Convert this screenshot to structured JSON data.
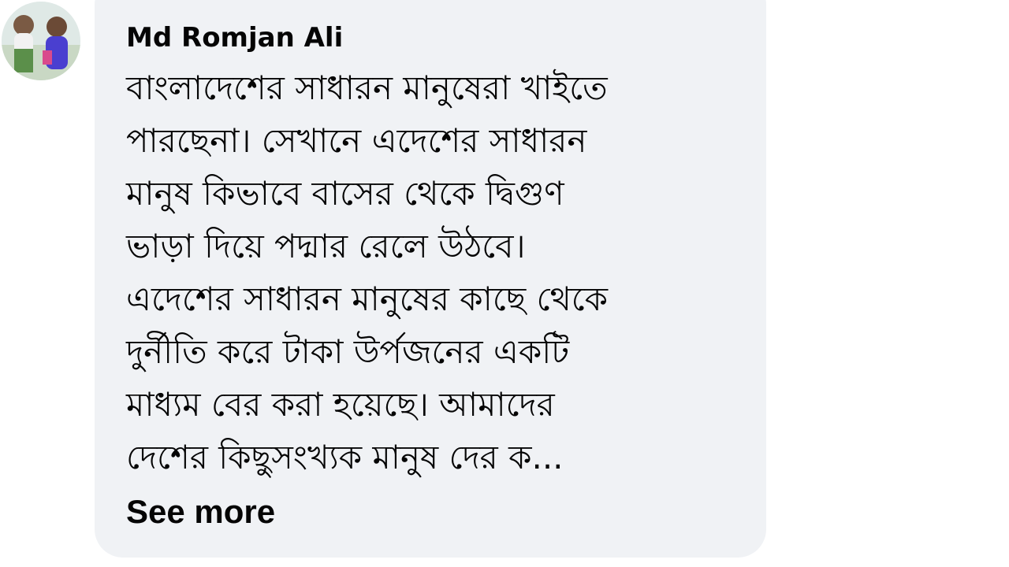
{
  "comment": {
    "author": "Md Romjan Ali",
    "avatar_icon": "profile-photo-avatar",
    "lines": [
      "বাংলাদেশের সাধারন মানুষেরা খাইতে",
      "পারছেনা। সেখানে এদেশের সাধারন",
      "মানুষ কিভাবে বাসের থেকে দ্বিগুণ",
      "ভাড়া দিয়ে পদ্মার রেলে উঠবে।",
      "এদেশের সাধারন মানুষের কাছে থেকে",
      "দুর্নীতি করে টাকা উর্পজনের একটি",
      "মাধ্যম বের করা হয়েছে। আমাদের",
      "দেশের কিছুসংখ্যক মানুষ দের ক..."
    ],
    "see_more_label": "See more"
  },
  "colors": {
    "bubble_background": "#f0f2f5",
    "text": "#050505",
    "page_background": "#ffffff"
  }
}
